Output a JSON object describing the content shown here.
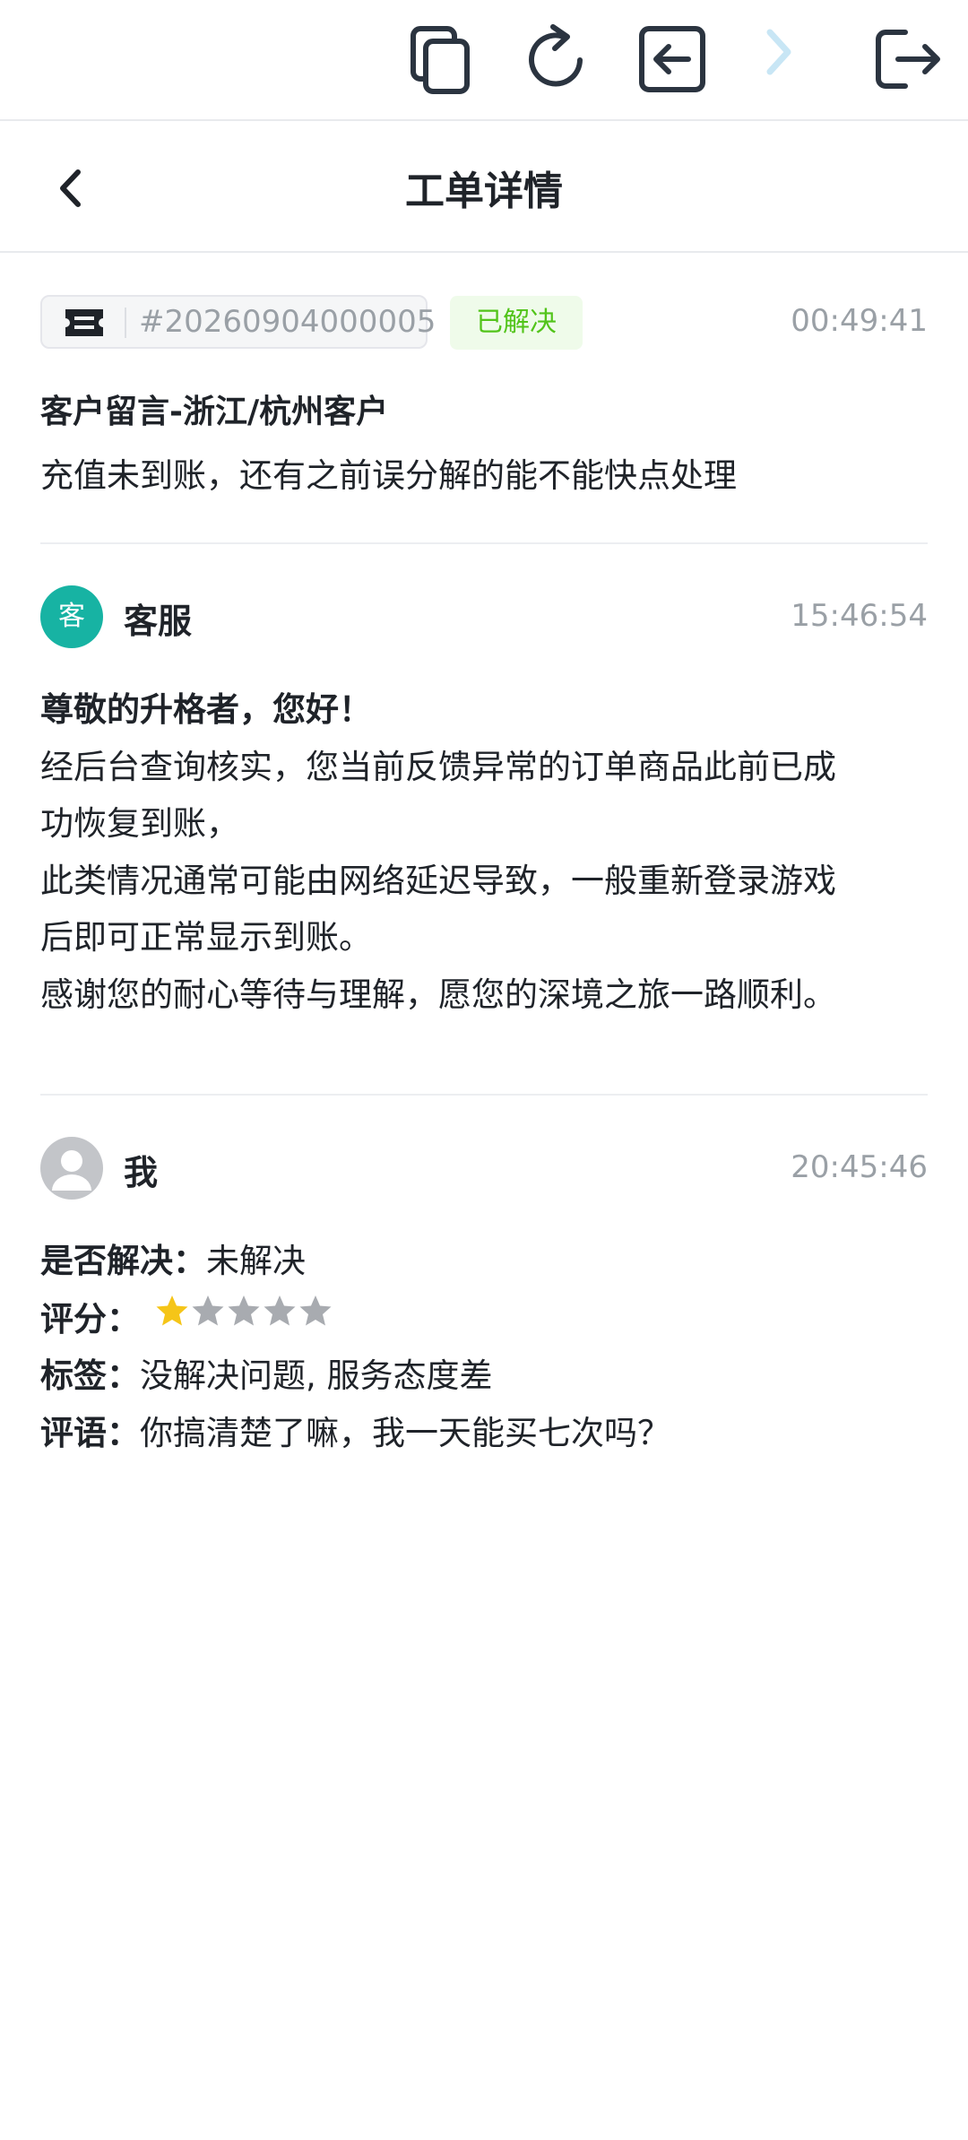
{
  "toolbar": {
    "icons": [
      "copy-icon",
      "refresh-icon",
      "back-box-icon",
      "forward-icon",
      "exit-icon"
    ]
  },
  "header": {
    "title": "工单详情"
  },
  "ticket": {
    "number": "#20260904000005",
    "status": "已解决",
    "time": "00:49:41",
    "title": "客户留言-浙江/杭州客户",
    "message": "充值未到账，还有之前误分解的能不能快点处理"
  },
  "reply": {
    "avatar_text": "客",
    "sender": "客服",
    "time": "15:46:54",
    "greeting": "尊敬的升格者，您好！",
    "lines": [
      "经后台查询核实，您当前反馈异常的订单商品此前已成",
      "功恢复到账，",
      "此类情况通常可能由网络延迟导致，一般重新登录游戏",
      "后即可正常显示到账。",
      "感谢您的耐心等待与理解，愿您的深境之旅一路顺利。"
    ]
  },
  "feedback": {
    "sender": "我",
    "time": "20:45:46",
    "resolved_label": "是否解决：",
    "resolved_value": "未解决",
    "rating_label": "评分：",
    "rating": 1,
    "rating_max": 5,
    "tags_label": "标签：",
    "tags_value": "没解决问题, 服务态度差",
    "comment_label": "评语：",
    "comment_value": "你搞清楚了嘛，我一天能买七次吗？"
  },
  "colors": {
    "status_green": "#52c41a",
    "cs_avatar": "#17b3a3",
    "star_filled": "#f5c518",
    "star_empty": "#a8abb0",
    "forward_disabled": "#c8e6f5"
  }
}
